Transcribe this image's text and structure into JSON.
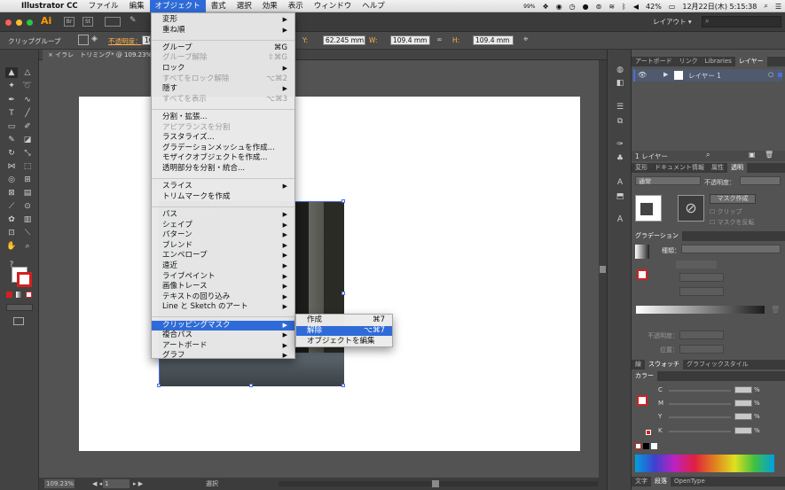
{
  "menubar": {
    "apple": "",
    "app_name": "Illustrator CC",
    "items": [
      "ファイル",
      "編集",
      "オブジェクト",
      "書式",
      "選択",
      "効果",
      "表示",
      "ウィンドウ",
      "ヘルプ"
    ],
    "active_index": 2,
    "status": {
      "battery_percent": "42%",
      "datetime": "12月22日(木) 5:15:38",
      "wifi_left": "99%"
    }
  },
  "appbar": {
    "ai_label": "Ai",
    "layout_label": "レイアウト ▾"
  },
  "control_bar": {
    "selection_label": "クリップグループ",
    "opacity_label": "不透明度：",
    "opacity_value": "10",
    "y_label": "Y:",
    "y_value": "62.245 mm",
    "w_label": "W:",
    "w_value": "109.4 mm",
    "h_label": "H:",
    "h_value": "109.4 mm"
  },
  "document_tab": {
    "label": "イラレ　トリミング* @ 109.23% (CMYK/プレビュー)",
    "close": "×"
  },
  "object_menu": {
    "rows": [
      {
        "label": "変形",
        "arrow": true
      },
      {
        "label": "重ね順",
        "arrow": true
      },
      {
        "sep": true
      },
      {
        "label": "グループ",
        "shortcut": "⌘G"
      },
      {
        "label": "グループ解除",
        "shortcut": "⇧⌘G",
        "disabled": true
      },
      {
        "label": "ロック",
        "arrow": true
      },
      {
        "label": "すべてをロック解除",
        "shortcut": "⌥⌘2",
        "disabled": true
      },
      {
        "label": "隠す",
        "arrow": true
      },
      {
        "label": "すべてを表示",
        "shortcut": "⌥⌘3",
        "disabled": true
      },
      {
        "sep": true
      },
      {
        "label": "分割・拡張..."
      },
      {
        "label": "アピアランスを分割",
        "disabled": true
      },
      {
        "label": "ラスタライズ..."
      },
      {
        "label": "グラデーションメッシュを作成..."
      },
      {
        "label": "モザイクオブジェクトを作成..."
      },
      {
        "label": "透明部分を分割・統合..."
      },
      {
        "sep": true
      },
      {
        "label": "スライス",
        "arrow": true
      },
      {
        "label": "トリムマークを作成"
      },
      {
        "sep": true
      },
      {
        "label": "パス",
        "arrow": true
      },
      {
        "label": "シェイプ",
        "arrow": true
      },
      {
        "label": "パターン",
        "arrow": true
      },
      {
        "label": "ブレンド",
        "arrow": true
      },
      {
        "label": "エンベロープ",
        "arrow": true
      },
      {
        "label": "遠近",
        "arrow": true
      },
      {
        "label": "ライブペイント",
        "arrow": true
      },
      {
        "label": "画像トレース",
        "arrow": true
      },
      {
        "label": "テキストの回り込み",
        "arrow": true
      },
      {
        "label": "Line と Sketch のアート",
        "arrow": true
      },
      {
        "sep": true
      },
      {
        "label": "クリッピングマスク",
        "arrow": true,
        "highlighted": true
      },
      {
        "label": "複合パス",
        "arrow": true
      },
      {
        "label": "アートボード",
        "arrow": true
      },
      {
        "label": "グラフ",
        "arrow": true
      }
    ]
  },
  "clipping_submenu": {
    "rows": [
      {
        "label": "作成",
        "shortcut": "⌘7"
      },
      {
        "label": "解除",
        "shortcut": "⌥⌘7",
        "highlighted": true
      },
      {
        "label": "オブジェクトを編集"
      }
    ]
  },
  "layers_panel": {
    "tabs": [
      "アートボード",
      "リンク",
      "Libraries",
      "レイヤー"
    ],
    "active_tab": 3,
    "layer_name": "レイヤー 1",
    "footer": "1 レイヤー"
  },
  "transparency_panel": {
    "tabs": [
      "変形",
      "ドキュメント情報",
      "属性",
      "透明"
    ],
    "active_tab": 3,
    "blend_mode": "通常",
    "opacity_label": "不透明度：",
    "mask_button": "マスク作成",
    "clip_label": "クリップ",
    "invert_label": "マスクを反転"
  },
  "gradient_panel": {
    "tab": "グラデーション",
    "type_label": "種類：",
    "opacity_label": "不透明度：",
    "position_label": "位置："
  },
  "swatch_tabs": {
    "tabs": [
      "線",
      "スウォッチ",
      "グラフィックスタイル"
    ],
    "active_tab": 1
  },
  "color_panel": {
    "tab": "カラー",
    "channels": [
      {
        "name": "C",
        "unit": "%"
      },
      {
        "name": "M",
        "unit": "%"
      },
      {
        "name": "Y",
        "unit": "%"
      },
      {
        "name": "K",
        "unit": "%"
      }
    ]
  },
  "bottom_tabs": {
    "tabs": [
      "文字",
      "段落",
      "OpenType"
    ],
    "active_tab": 1
  },
  "status_bar": {
    "zoom": "109.23%",
    "page": "1",
    "tool": "選択"
  },
  "colors": {
    "menu_highlight": "#2f6bd8",
    "selection_box": "#4a6ee0",
    "opacity_label": "#ffb04a"
  }
}
